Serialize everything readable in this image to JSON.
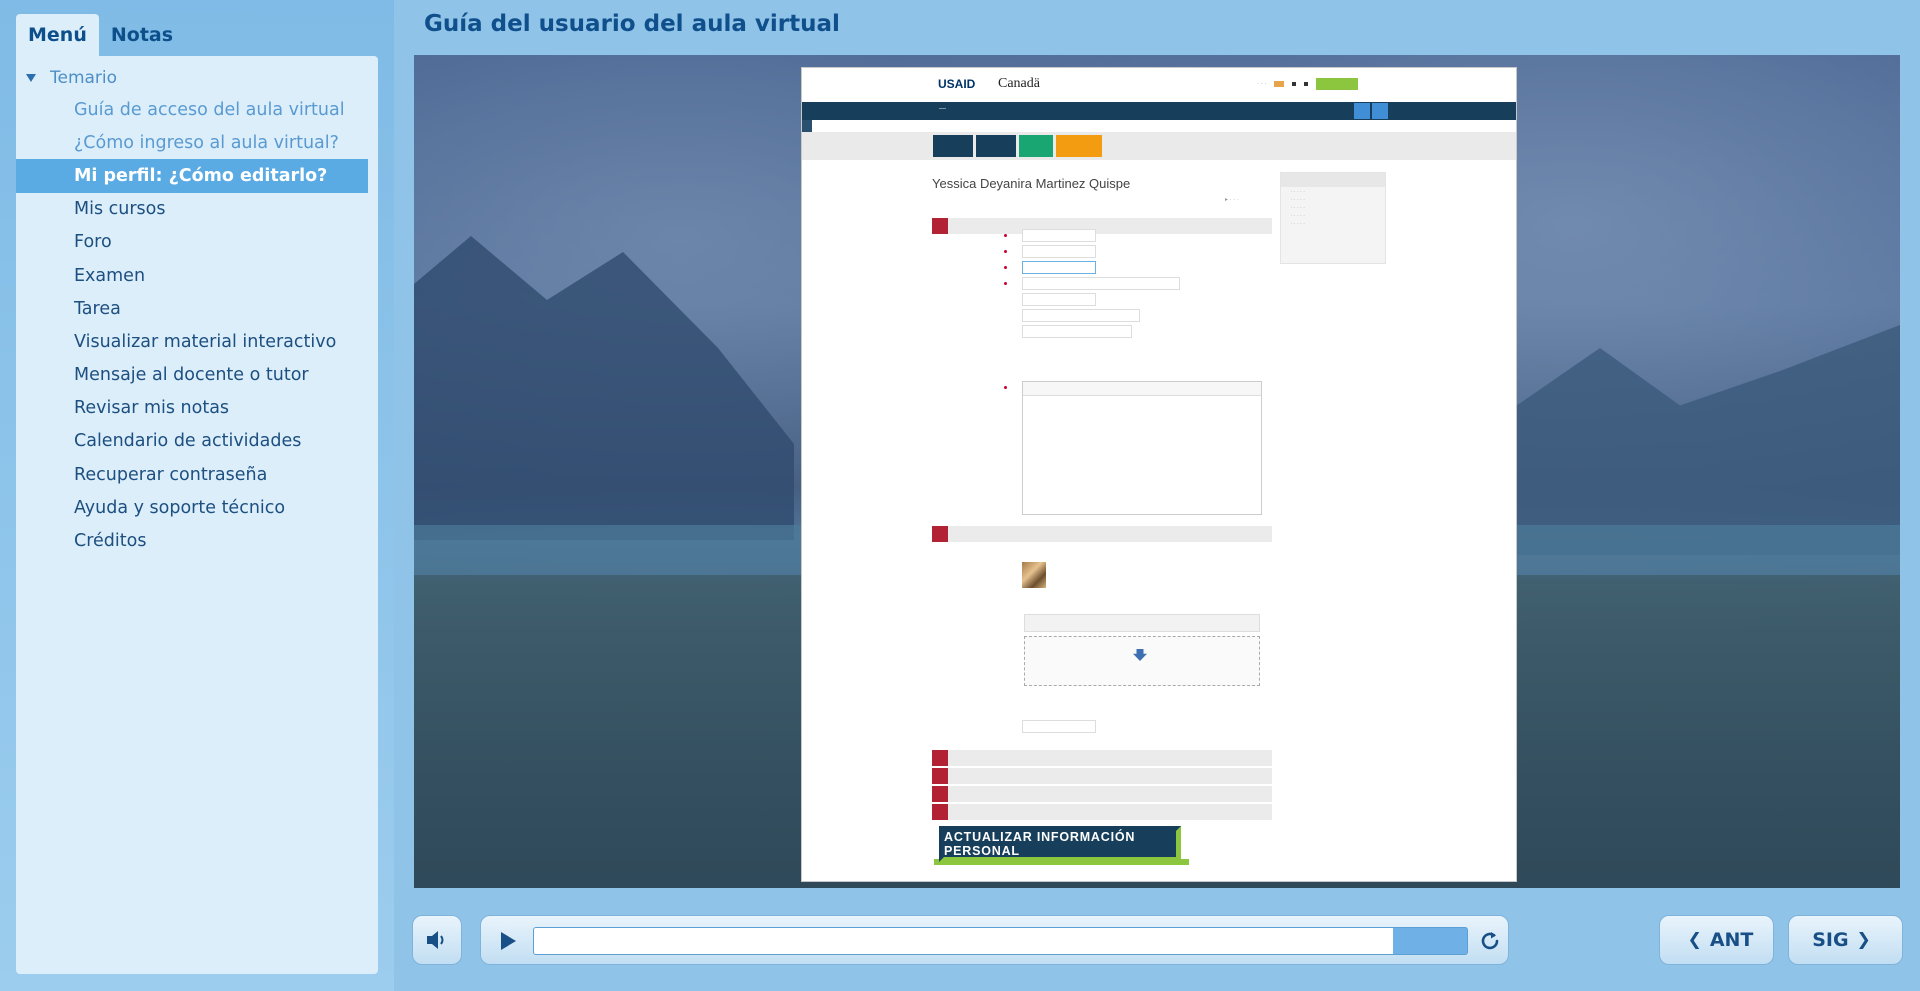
{
  "sidebar": {
    "tabs": {
      "menu": "Menú",
      "notes": "Notas"
    },
    "section_title": "Temario",
    "items": [
      {
        "label": "Guía de acceso del aula virtual",
        "state": "visited"
      },
      {
        "label": "¿Cómo ingreso al aula virtual?",
        "state": "visited"
      },
      {
        "label": "Mi perfil: ¿Cómo editarlo?",
        "state": "selected"
      },
      {
        "label": "Mis cursos",
        "state": "normal"
      },
      {
        "label": "Foro",
        "state": "normal"
      },
      {
        "label": "Examen",
        "state": "normal"
      },
      {
        "label": "Tarea",
        "state": "normal"
      },
      {
        "label": "Visualizar material interactivo",
        "state": "normal"
      },
      {
        "label": "Mensaje al docente o tutor",
        "state": "normal"
      },
      {
        "label": "Revisar mis notas",
        "state": "normal"
      },
      {
        "label": "Calendario de actividades",
        "state": "normal"
      },
      {
        "label": "Recuperar contraseña",
        "state": "normal"
      },
      {
        "label": "Ayuda y soporte técnico",
        "state": "normal"
      },
      {
        "label": "Créditos",
        "state": "normal"
      }
    ]
  },
  "main": {
    "title": "Guía del usuario del aula virtual"
  },
  "slide": {
    "logo_usaid": "USAID",
    "logo_canada": "Canadä",
    "profile_name": "Yessica Deyanira Martinez Quispe",
    "cta_button": "ACTUALIZAR INFORMACIÓN PERSONAL"
  },
  "player": {
    "progress": 0.921,
    "prev_label": "ANT",
    "next_label": "SIG",
    "icons": [
      "volume-icon",
      "play-icon",
      "replay-icon",
      "chevron-left-icon",
      "chevron-right-icon"
    ]
  },
  "colors": {
    "accent": "#0f4f8c",
    "selected_bg": "#5aaae4",
    "cta_border": "#8cc63f",
    "navbar": "#173e5a"
  }
}
